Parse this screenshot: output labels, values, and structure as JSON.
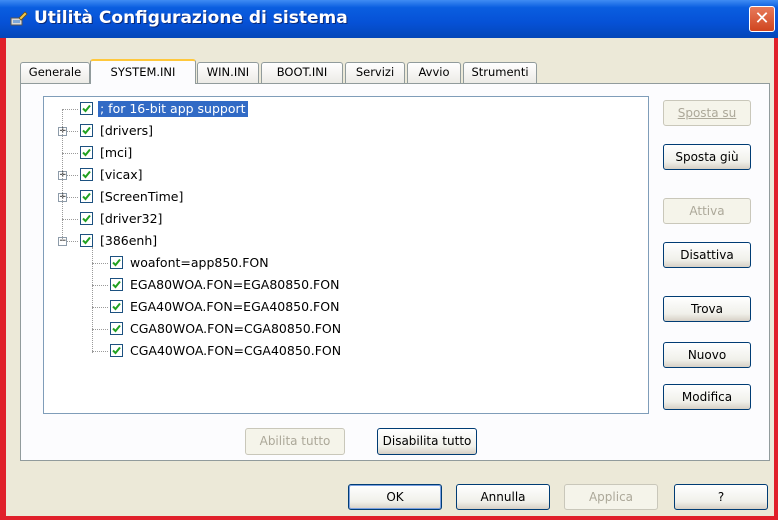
{
  "window": {
    "title": "Utilità Configurazione di sistema",
    "close_label": "✕"
  },
  "tabs": [
    {
      "label": "Generale",
      "active": false
    },
    {
      "label": "SYSTEM.INI",
      "active": true
    },
    {
      "label": "WIN.INI",
      "active": false
    },
    {
      "label": "BOOT.INI",
      "active": false
    },
    {
      "label": "Servizi",
      "active": false
    },
    {
      "label": "Avvio",
      "active": false
    },
    {
      "label": "Strumenti",
      "active": false
    }
  ],
  "tree": {
    "items": [
      {
        "label": "; for 16-bit app support",
        "checked": true,
        "selected": true,
        "expander": ""
      },
      {
        "label": "[drivers]",
        "checked": true,
        "selected": false,
        "expander": "+"
      },
      {
        "label": "[mci]",
        "checked": true,
        "selected": false,
        "expander": ""
      },
      {
        "label": "[vicax]",
        "checked": true,
        "selected": false,
        "expander": "+"
      },
      {
        "label": "[ScreenTime]",
        "checked": true,
        "selected": false,
        "expander": "+"
      },
      {
        "label": "[driver32]",
        "checked": true,
        "selected": false,
        "expander": ""
      },
      {
        "label": "[386enh]",
        "checked": true,
        "selected": false,
        "expander": "−"
      },
      {
        "label": "woafont=app850.FON",
        "checked": true,
        "selected": false,
        "expander": ""
      },
      {
        "label": "EGA80WOA.FON=EGA80850.FON",
        "checked": true,
        "selected": false,
        "expander": ""
      },
      {
        "label": "EGA40WOA.FON=EGA40850.FON",
        "checked": true,
        "selected": false,
        "expander": ""
      },
      {
        "label": "CGA80WOA.FON=CGA80850.FON",
        "checked": true,
        "selected": false,
        "expander": ""
      },
      {
        "label": "CGA40WOA.FON=CGA40850.FON",
        "checked": true,
        "selected": false,
        "expander": ""
      }
    ]
  },
  "side_buttons": {
    "move_up": "Sposta su",
    "move_down": "Sposta giù",
    "enable": "Attiva",
    "disable": "Disattiva",
    "find": "Trova",
    "new": "Nuovo",
    "edit": "Modifica"
  },
  "bottom_buttons": {
    "enable_all": "Abilita tutto",
    "disable_all": "Disabilita tutto"
  },
  "dialog_buttons": {
    "ok": "OK",
    "cancel": "Annulla",
    "apply": "Applica",
    "help": "?"
  },
  "colors": {
    "titlebar": "#0651d6",
    "selection": "#316ac5",
    "frame": "#e0202a"
  }
}
